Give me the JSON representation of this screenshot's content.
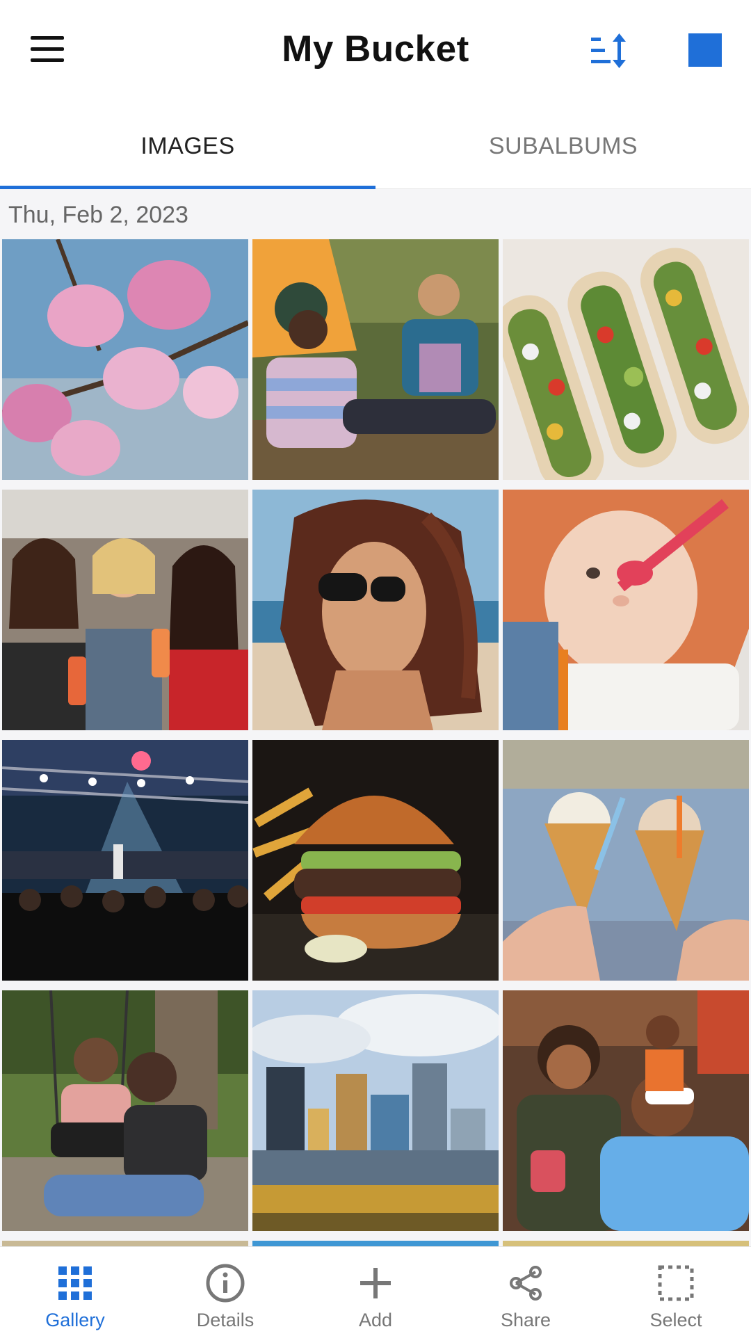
{
  "header": {
    "title": "My Bucket",
    "icons": {
      "menu": "hamburger-menu-icon",
      "sort": "sort-order-icon",
      "select_all": "square-icon"
    }
  },
  "tabs": [
    {
      "label": "IMAGES",
      "active": true
    },
    {
      "label": "SUBALBUMS",
      "active": false
    }
  ],
  "gallery": {
    "date_header": "Thu, Feb 2, 2023",
    "images": [
      {
        "name": "magnolia-blossoms"
      },
      {
        "name": "friends-camping"
      },
      {
        "name": "vegetable-tacos"
      },
      {
        "name": "women-toasting-drinks"
      },
      {
        "name": "woman-sunglasses-beach"
      },
      {
        "name": "baby-eating"
      },
      {
        "name": "concert-crowd"
      },
      {
        "name": "burger-and-fries"
      },
      {
        "name": "ice-cream-cones"
      },
      {
        "name": "father-child-swing"
      },
      {
        "name": "city-skyline"
      },
      {
        "name": "friends-selfie"
      }
    ]
  },
  "bottom_nav": [
    {
      "label": "Gallery",
      "icon": "grid-icon",
      "active": true
    },
    {
      "label": "Details",
      "icon": "info-icon",
      "active": false
    },
    {
      "label": "Add",
      "icon": "plus-icon",
      "active": false
    },
    {
      "label": "Share",
      "icon": "share-icon",
      "active": false
    },
    {
      "label": "Select",
      "icon": "select-icon",
      "active": false
    }
  ],
  "colors": {
    "accent": "#1f6fd8",
    "text_primary": "#111111",
    "text_secondary": "#777777"
  }
}
